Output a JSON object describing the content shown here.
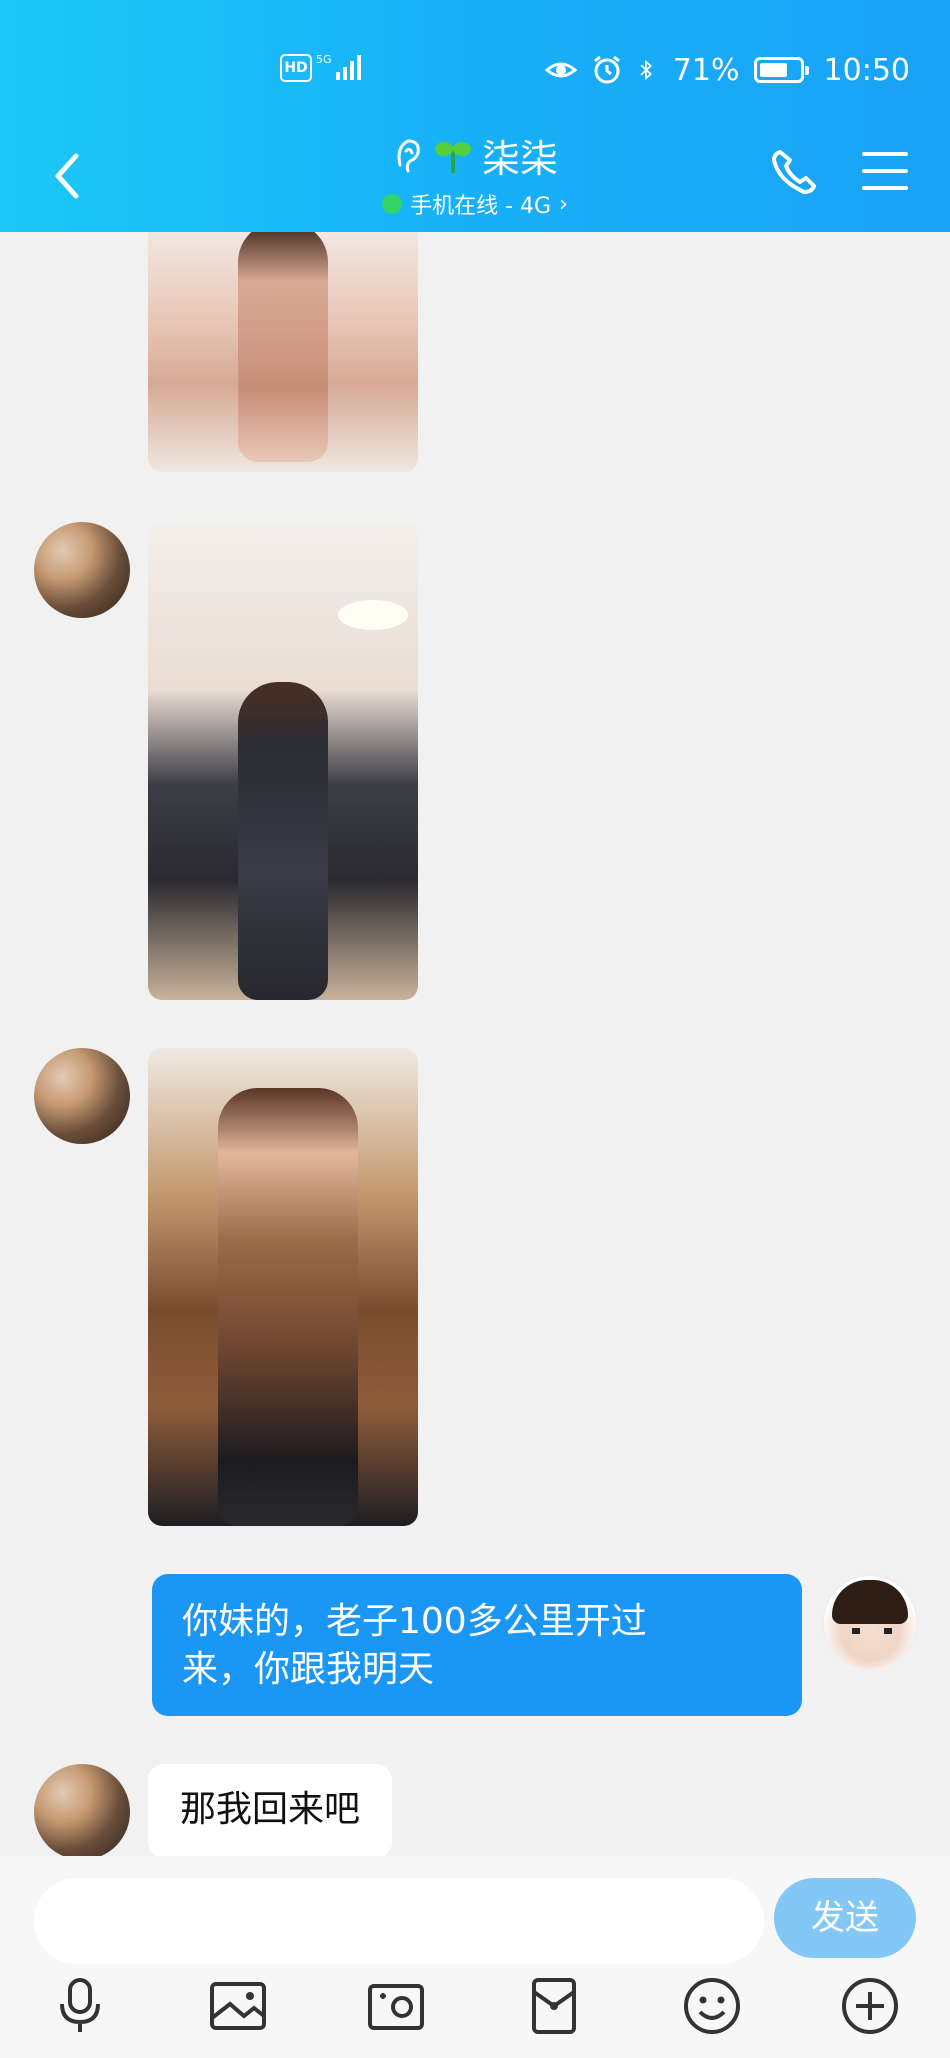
{
  "status_bar": {
    "hd_label": "HD",
    "network_label": "5G",
    "battery_percent": "71%",
    "battery_level": 0.71,
    "time": "10:50"
  },
  "header": {
    "contact_name": "柒柒",
    "online_status": "手机在线 - 4G",
    "status_color": "#34d46a"
  },
  "messages": [
    {
      "from": "her",
      "type": "image",
      "subject": "pink sequin dress"
    },
    {
      "from": "her",
      "type": "image",
      "subject": "black leather jumpsuit"
    },
    {
      "from": "her",
      "type": "image",
      "subject": "leopard print dress"
    },
    {
      "from": "me",
      "type": "text",
      "lines": [
        "你妹的，老子100多公里开过",
        "来，你跟我明天"
      ]
    },
    {
      "from": "her",
      "type": "text",
      "text": "那我回来吧"
    }
  ],
  "composer": {
    "input_value": "",
    "send_label": "发送"
  },
  "toolbar": {
    "icons": [
      "microphone-icon",
      "photo-icon",
      "camera-icon",
      "red-packet-icon",
      "emoji-icon",
      "plus-icon"
    ]
  },
  "colors": {
    "header_accent": "#17b0f8",
    "my_bubble": "#1a96f5",
    "send_button": "#83c7f6"
  }
}
